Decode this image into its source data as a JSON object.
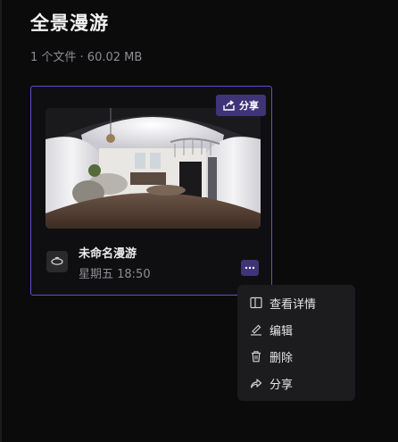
{
  "page": {
    "title": "全景漫游",
    "meta": "1 个文件 · 60.02 MB"
  },
  "card": {
    "share_label": "分享",
    "name": "未命名漫游",
    "time": "星期五 18:50"
  },
  "menu": {
    "items": [
      {
        "label": "查看详情",
        "icon": "panel-icon"
      },
      {
        "label": "编辑",
        "icon": "edit-icon"
      },
      {
        "label": "删除",
        "icon": "trash-icon"
      },
      {
        "label": "分享",
        "icon": "share-arrow-icon"
      }
    ]
  },
  "colors": {
    "accent": "#6a4bd6",
    "button_bg": "#3f3478",
    "background": "#0b0b0c",
    "menu_bg": "#1c1c1f"
  }
}
